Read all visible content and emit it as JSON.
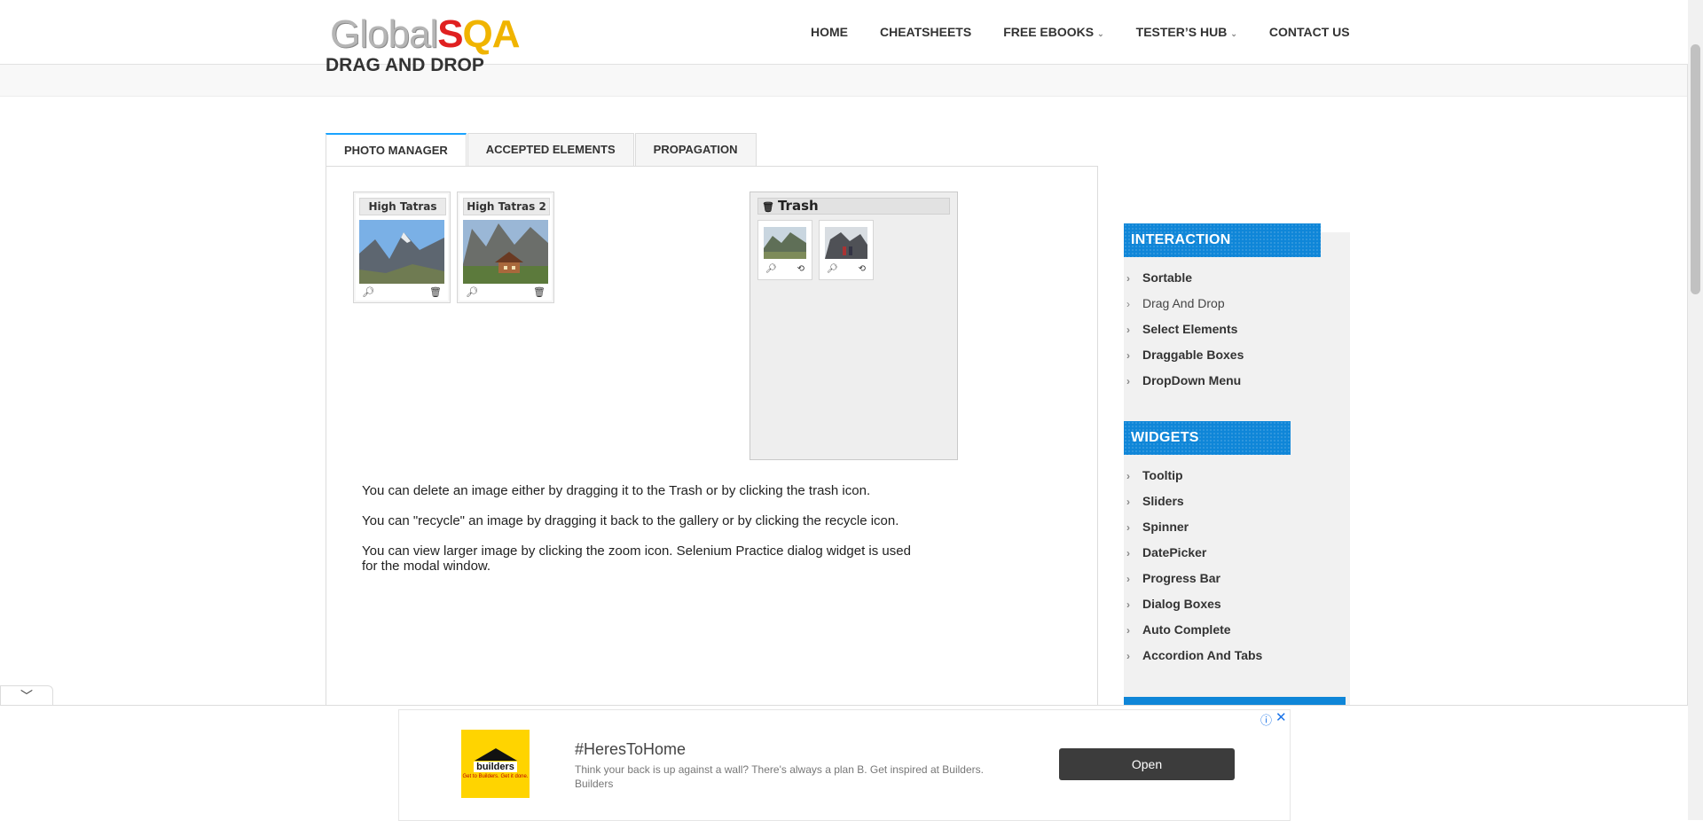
{
  "header": {
    "logo": {
      "part1": "Global",
      "part2": "S",
      "part3": "QA"
    },
    "nav": [
      {
        "label": "HOME",
        "caret": ""
      },
      {
        "label": "CHEATSHEETS",
        "caret": ""
      },
      {
        "label": "FREE EBOOKS",
        "caret": "⌄"
      },
      {
        "label": "TESTER’S HUB",
        "caret": "⌄"
      },
      {
        "label": "CONTACT US",
        "caret": ""
      }
    ]
  },
  "page": {
    "title": "DRAG AND DROP"
  },
  "tabs": [
    "PHOTO MANAGER",
    "ACCEPTED ELEMENTS",
    "PROPAGATION"
  ],
  "gallery": [
    {
      "title": "High Tatras",
      "icons": [
        "zoom-icon",
        "trash-icon"
      ]
    },
    {
      "title": "High Tatras 2",
      "icons": [
        "zoom-icon",
        "trash-icon"
      ]
    }
  ],
  "trash": {
    "label": "Trash",
    "items": [
      {
        "icons": [
          "zoom-icon",
          "recycle-icon"
        ]
      },
      {
        "icons": [
          "zoom-icon",
          "recycle-icon"
        ]
      }
    ]
  },
  "instructions": [
    "You can delete an image either by dragging it to the Trash or by clicking the trash icon.",
    "You can \"recycle\" an image by dragging it back to the gallery or by clicking the recycle icon.",
    "You can view larger image by clicking the zoom icon. Selenium Practice dialog widget is used for the modal window."
  ],
  "sidebar": {
    "interaction": {
      "heading": "INTERACTION",
      "items": [
        "Sortable",
        "Drag And Drop",
        "Select Elements",
        "Draggable Boxes",
        "DropDown Menu"
      ]
    },
    "widgets": {
      "heading": "WIDGETS",
      "items": [
        "Tooltip",
        "Sliders",
        "Spinner",
        "DatePicker",
        "Progress Bar",
        "Dialog Boxes",
        "Auto Complete",
        "Accordion And Tabs"
      ]
    }
  },
  "ad": {
    "logo_word": "builders",
    "logo_tagline": "Get to Builders. Get it done.",
    "title": "#HeresToHome",
    "description": "Think your back is up against a wall? There's always a plan B. Get inspired at Builders. Builders",
    "cta": "Open",
    "info_icon": "ⓘ",
    "close_icon": "✕"
  },
  "colors": {
    "accent": "#0f86d8",
    "tab_active_border": "#1aa3ff",
    "ad_button": "#3c3c3c"
  }
}
